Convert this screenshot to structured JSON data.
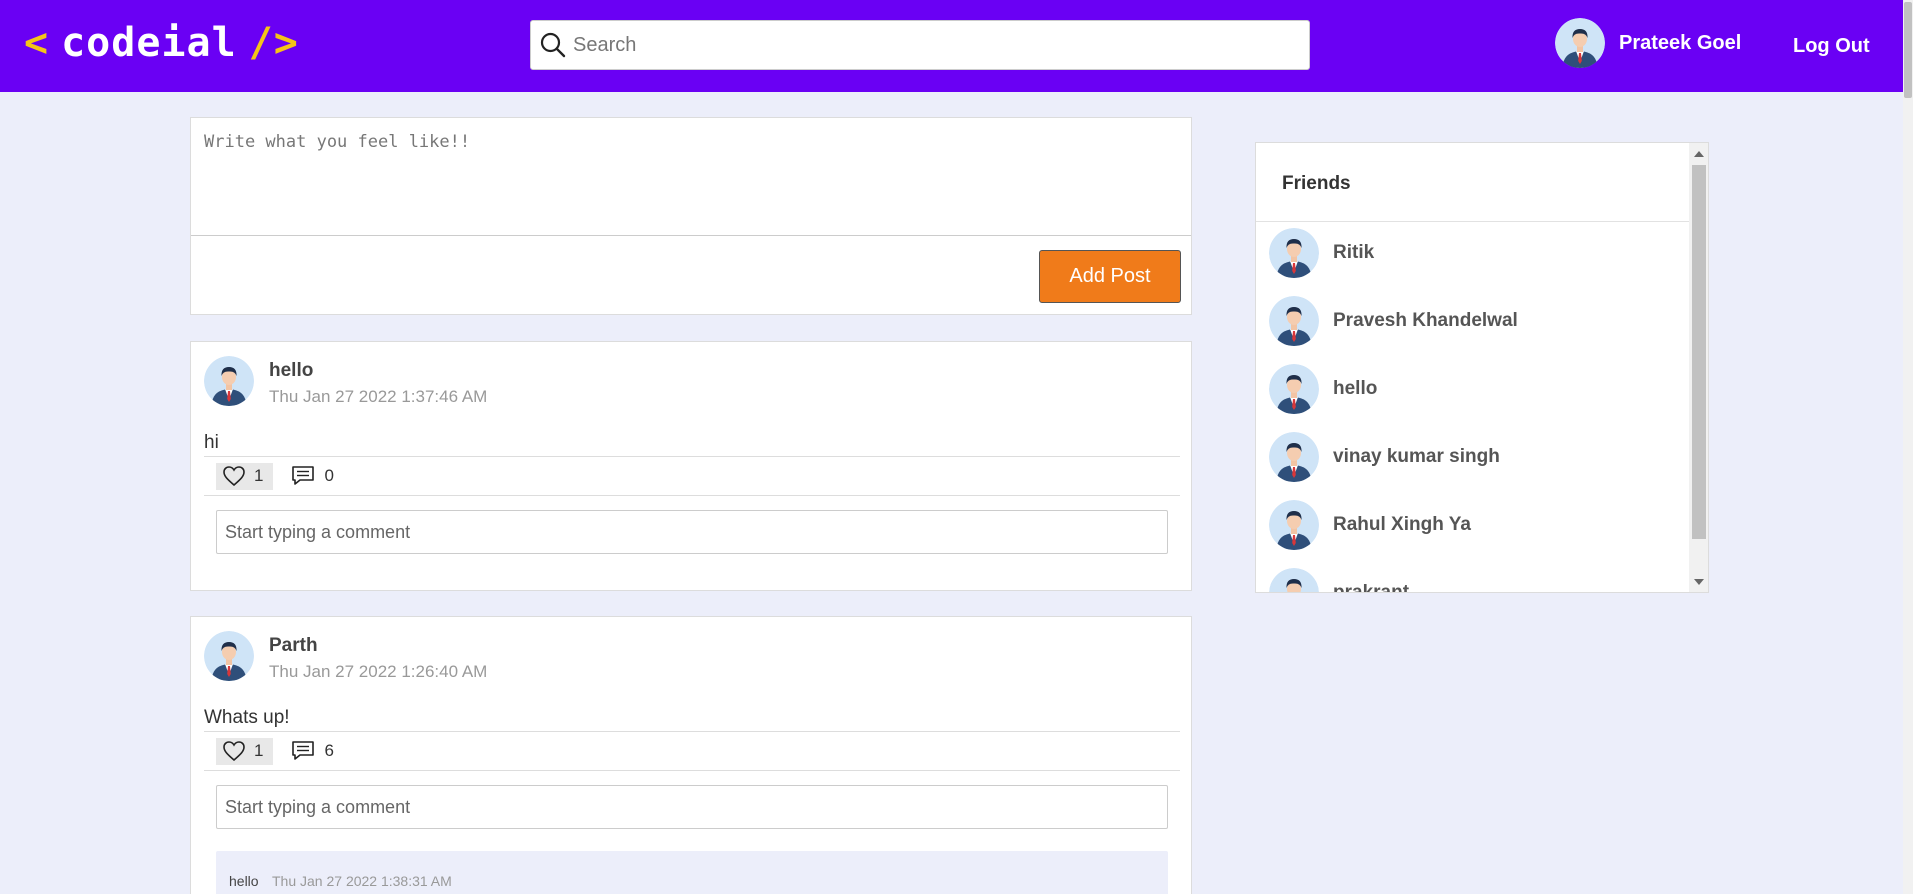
{
  "header": {
    "logo": {
      "left_bracket": "<",
      "name": "codeial",
      "right_bracket": "/>"
    },
    "search": {
      "placeholder": "Search",
      "value": ""
    },
    "user": {
      "name": "Prateek Goel"
    },
    "logout_label": "Log Out"
  },
  "composer": {
    "placeholder": "Write what you feel like!!",
    "value": "",
    "add_post_label": "Add Post"
  },
  "posts": [
    {
      "author": "hello",
      "time": "Thu Jan 27 2022 1:37:46 AM",
      "content": "hi",
      "likes": "1",
      "comments_count": "0",
      "comment_placeholder": "Start typing a comment",
      "comments": []
    },
    {
      "author": "Parth",
      "time": "Thu Jan 27 2022 1:26:40 AM",
      "content": "Whats up!",
      "likes": "1",
      "comments_count": "6",
      "comment_placeholder": "Start typing a comment",
      "comments": [
        {
          "author": "hello",
          "time": "Thu Jan 27 2022 1:38:31 AM"
        }
      ]
    }
  ],
  "friends": {
    "title": "Friends",
    "list": [
      {
        "name": "Ritik"
      },
      {
        "name": "Pravesh Khandelwal"
      },
      {
        "name": "hello"
      },
      {
        "name": "vinay kumar singh"
      },
      {
        "name": "Rahul Xingh Ya"
      },
      {
        "name": "prakrant"
      }
    ]
  },
  "colors": {
    "header_bg": "#6a00f4",
    "logo_bracket": "#f5c518",
    "page_bg": "#eceefa",
    "add_post_button": "#f07b1a"
  },
  "icons": {
    "search": "search-icon",
    "avatar": "avatar-icon",
    "like": "heart-icon",
    "comment": "comment-icon"
  }
}
